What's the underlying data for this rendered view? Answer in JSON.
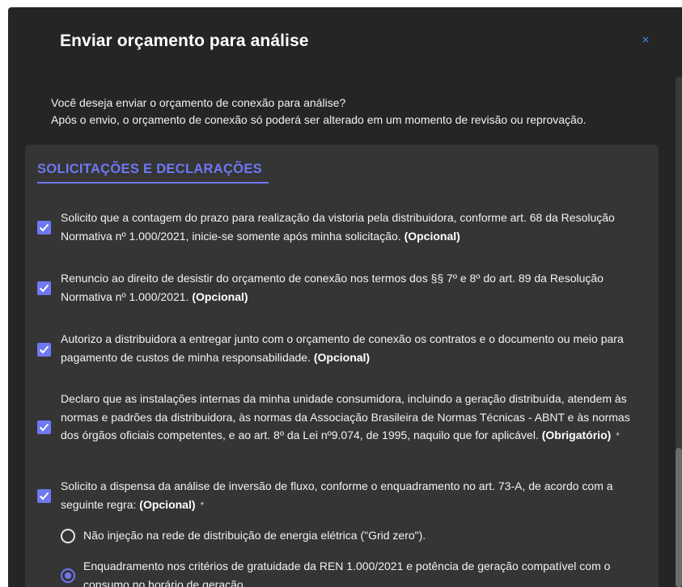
{
  "dialog": {
    "title": "Enviar orçamento para análise",
    "close_symbol": "×",
    "intro_line1": "Você deseja enviar o orçamento de conexão para análise?",
    "intro_line2": "Após o envio, o orçamento de conexão só poderá ser alterado em um momento de revisão ou reprovação."
  },
  "section": {
    "title": "SOLICITAÇÕES E DECLARAÇÕES",
    "items": [
      {
        "text": "Solicito que a contagem do prazo para realização da vistoria pela distribuidora, conforme art. 68 da Resolução Normativa nº 1.000/2021, inicie-se somente após minha solicitação.",
        "tag": "(Opcional)",
        "checked": true
      },
      {
        "text": "Renuncio ao direito de desistir do orçamento de conexão nos termos dos §§ 7º e 8º do art. 89 da Resolução Normativa nº 1.000/2021.",
        "tag": "(Opcional)",
        "checked": true
      },
      {
        "text": "Autorizo a distribuidora a entregar junto com o orçamento de conexão os contratos e o documento ou meio para pagamento de custos de minha responsabilidade.",
        "tag": "(Opcional)",
        "checked": true
      },
      {
        "text": "Declaro que as instalações internas da minha unidade consumidora, incluindo a geração distribuída, atendem às normas e padrões da distribuidora, às normas da Associação Brasileira de Normas Técnicas - ABNT e às normas dos órgãos oficiais competentes, e ao art. 8º da Lei nº9.074, de 1995, naquilo que for aplicável.",
        "tag": "(Obrigatório)",
        "required_mark": "*",
        "checked": true
      },
      {
        "text": "Solicito a dispensa da análise de inversão de fluxo, conforme o enquadramento no art. 73-A, de acordo com a seguinte regra:",
        "tag": "(Opcional)",
        "required_mark": "*",
        "checked": true
      }
    ],
    "radio_options": [
      {
        "label": "Não injeção na rede de distribuição de energia elétrica (\"Grid zero\").",
        "selected": false
      },
      {
        "label": "Enquadramento nos critérios de gratuidade da REN 1.000/2021 e potência de geração compatível com o consumo no horário de geração.",
        "selected": true
      }
    ]
  },
  "colors": {
    "accent": "#6f78f2",
    "dialog_bg": "#252525",
    "panel_bg": "#353535",
    "close_icon": "#3f8df0"
  },
  "icons": {
    "close": "close-icon",
    "check": "checkmark-icon"
  }
}
